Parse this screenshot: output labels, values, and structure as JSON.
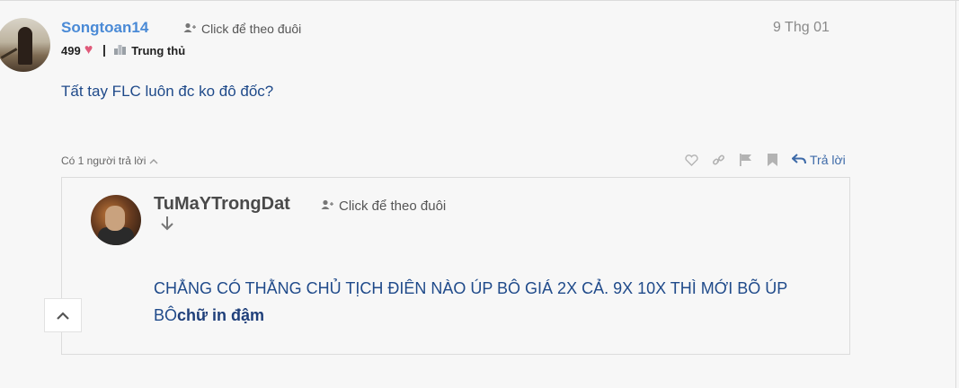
{
  "post": {
    "username": "Songtoan14",
    "follow_label": "Click để theo đuôi",
    "date": "9 Thg 01",
    "likes": "499",
    "rank": "Trung thủ",
    "content": "Tất tay FLC luôn đc ko đô đốc?"
  },
  "thread": {
    "replies_label": "Có 1 người trả lời",
    "reply_label": "Trả lời"
  },
  "reply": {
    "username": "TuMaYTrongDat",
    "follow_label": "Click để theo đuôi",
    "content_text": "CHẲNG CÓ THẰNG CHỦ TỊCH ĐIÊN NÀO ÚP BÔ GIÁ 2X CẢ. 9X 10X THÌ MỚI BÕ ÚP BÔ",
    "content_bold": "chữ in đậm"
  },
  "icons": {
    "follow": "user-plus-icon",
    "heart": "heart-icon",
    "rank": "trophy-icon",
    "collapse": "chevron-up-icon",
    "like": "heart-outline-icon",
    "link": "link-icon",
    "report": "flag-icon",
    "bookmark": "bookmark-icon",
    "reply": "reply-arrow-icon",
    "expand": "arrow-down-icon",
    "scroll_top": "chevron-up-icon"
  },
  "colors": {
    "username": "#4a8ad6",
    "content": "#1f4a8a",
    "heart": "#e05a7a",
    "reply_action": "#3d6aa8"
  }
}
